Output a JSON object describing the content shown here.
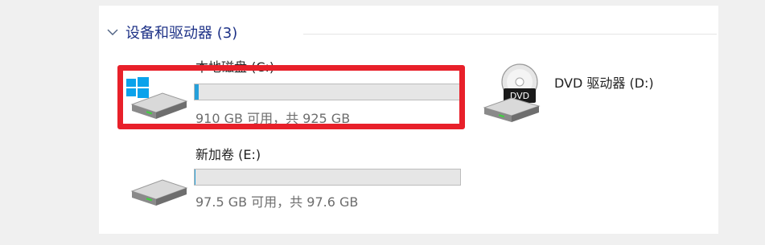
{
  "section": {
    "title": "设备和驱动器 (3)",
    "expanded": true
  },
  "drives": [
    {
      "name": "本地磁盘 (C:)",
      "stats": "910 GB 可用，共 925 GB",
      "used_fraction": 0.016,
      "icon": "windows-drive-icon"
    },
    {
      "name": "DVD 驱动器 (D:)",
      "icon": "dvd-drive-icon",
      "dvd_label": "DVD"
    },
    {
      "name": "新加卷 (E:)",
      "stats": "97.5 GB 可用，共 97.6 GB",
      "used_fraction": 0.001,
      "icon": "hard-drive-icon"
    }
  ],
  "colors": {
    "highlight": "#e8202a",
    "bar_fill": "#26a0da",
    "windows_logo": "#0aa2eb"
  }
}
